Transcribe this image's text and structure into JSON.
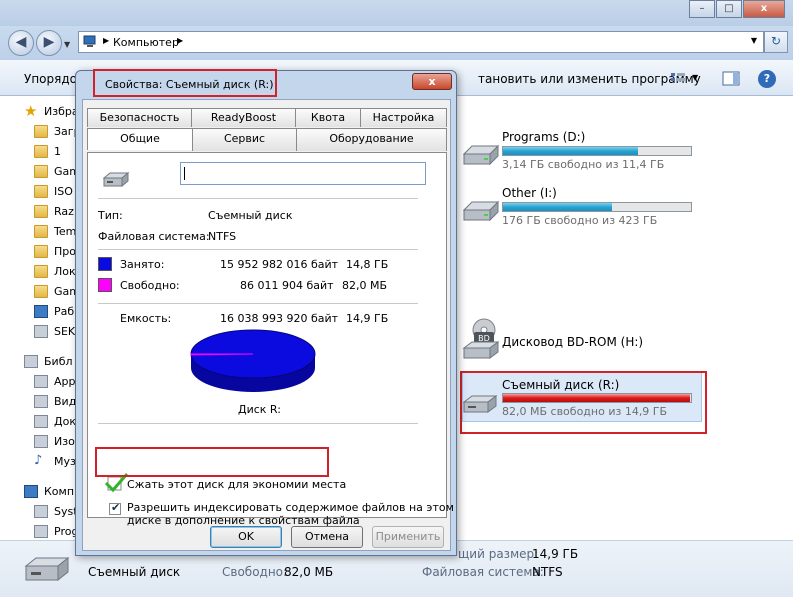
{
  "explorer": {
    "address": "Компьютер",
    "toolbar": {
      "organize": "Упорядо",
      "uninstall": "тановить или изменить программу"
    },
    "nav_items": [
      {
        "label": "Избра",
        "icon": "star-icon"
      },
      {
        "label": "Загр",
        "icon": "folder-icon"
      },
      {
        "label": "1",
        "icon": "folder-icon"
      },
      {
        "label": "Gam",
        "icon": "folder-icon"
      },
      {
        "label": "ISO",
        "icon": "folder-icon"
      },
      {
        "label": "Raz",
        "icon": "folder-icon"
      },
      {
        "label": "Tem",
        "icon": "folder-icon"
      },
      {
        "label": "Про",
        "icon": "folder-icon"
      },
      {
        "label": "Лок",
        "icon": "folder-icon"
      },
      {
        "label": "Gam",
        "icon": "folder-icon"
      },
      {
        "label": "Раб",
        "icon": "desktop-icon"
      },
      {
        "label": "SEK",
        "icon": "drive-icon"
      },
      {
        "label": "Библ",
        "icon": "library-icon"
      },
      {
        "label": "App",
        "icon": "app-icon"
      },
      {
        "label": "Вид",
        "icon": "video-icon"
      },
      {
        "label": "Док",
        "icon": "document-icon"
      },
      {
        "label": "Изо",
        "icon": "image-icon"
      },
      {
        "label": "Муз",
        "icon": "music-icon"
      },
      {
        "label": "Компь",
        "icon": "computer-icon"
      },
      {
        "label": "Syst",
        "icon": "drive-icon"
      },
      {
        "label": "Prog",
        "icon": "drive-icon"
      }
    ],
    "drives": [
      {
        "name": "Programs (D:)",
        "free_text": "3,14 ГБ свободно из 11,4 ГБ",
        "used_fraction": 0.72
      },
      {
        "name": "Other (I:)",
        "free_text": "176 ГБ свободно из 423 ГБ",
        "used_fraction": 0.58
      },
      {
        "name": "Дисковод BD-ROM (H:)"
      },
      {
        "name": "Съемный диск (R:)",
        "free_text": "82,0 МБ свободно из 14,9 ГБ",
        "used_fraction": 0.995
      }
    ],
    "details": {
      "name": "Съемный диск",
      "free_label": "Свободно:",
      "free_value": "82,0 МБ",
      "total_label": "щий размер:",
      "total_value": "14,9 ГБ",
      "fs_label": "Файловая система:",
      "fs_value": "NTFS"
    }
  },
  "dialog": {
    "title": "Свойства: Съемный диск (R:)",
    "close": "x",
    "tabs_row1": [
      "Безопасность",
      "ReadyBoost",
      "Квота",
      "Настройка"
    ],
    "tabs_row2": [
      "Общие",
      "Сервис",
      "Оборудование"
    ],
    "name_value": "",
    "type_label": "Тип:",
    "type_value": "Съемный диск",
    "fs_label": "Файловая система:",
    "fs_value": "NTFS",
    "used_label": "Занято:",
    "used_bytes": "15 952 982 016 байт",
    "used_size": "14,8 ГБ",
    "free_label": "Свободно:",
    "free_bytes": "86 011 904 байт",
    "free_size": "82,0 МБ",
    "capacity_label": "Емкость:",
    "capacity_bytes": "16 038 993 920 байт",
    "capacity_size": "14,9 ГБ",
    "disk_label": "Диск R:",
    "compress_label": "Сжать этот диск для экономии места",
    "index_label_1": "Разрешить индексировать содержимое файлов на этом",
    "index_label_2": "диске в дополнение к свойствам файла",
    "ok": "OK",
    "cancel": "Отмена",
    "apply": "Применить",
    "colors": {
      "used": "#0b0bdf",
      "free": "#ff00ff"
    },
    "pie": {
      "used_fraction": 0.9946,
      "free_fraction": 0.0054
    }
  }
}
